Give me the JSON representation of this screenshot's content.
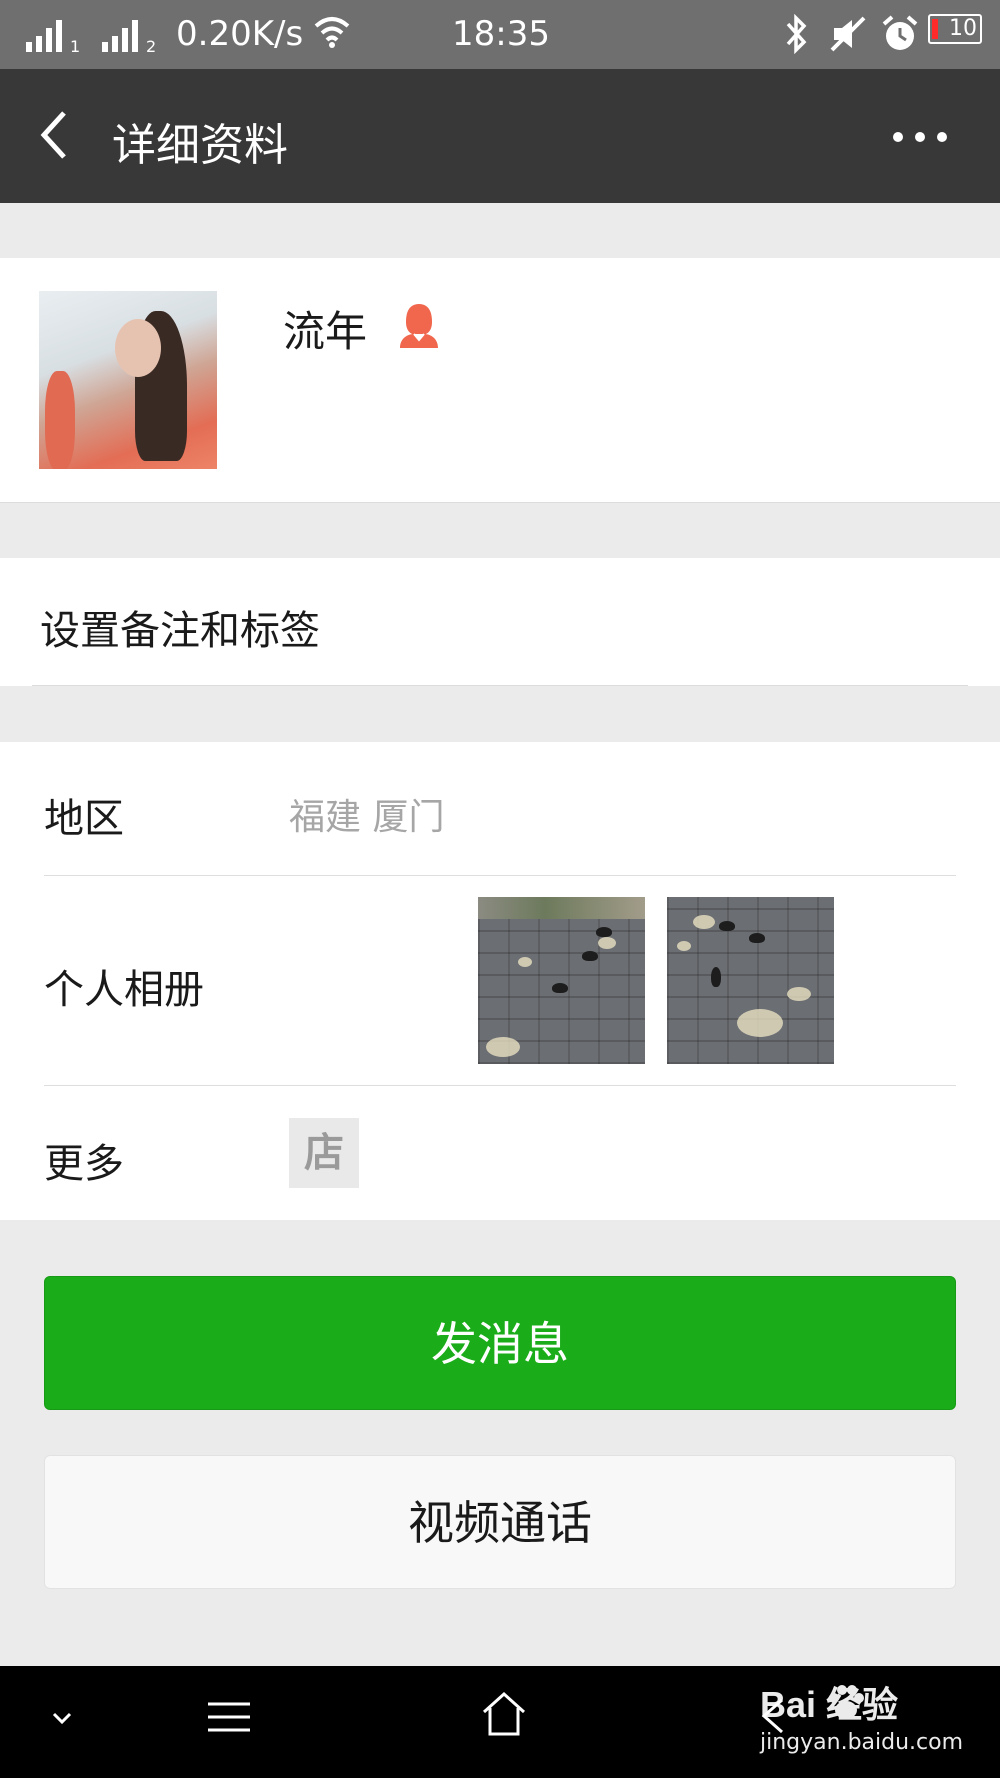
{
  "status_bar": {
    "sim1_label": "1",
    "sim2_label": "2",
    "network_speed": "0.20K/s",
    "time": "18:35",
    "battery_level": "10",
    "icons": [
      "signal-icon",
      "wifi-icon",
      "bluetooth-icon",
      "mute-icon",
      "alarm-icon",
      "battery-icon"
    ]
  },
  "title_bar": {
    "title": "详细资料",
    "back_icon": "chevron-left-icon",
    "more_icon": "more-dots-icon"
  },
  "profile": {
    "name": "流年",
    "gender_icon": "female-user-icon",
    "gender_color": "#f0674d"
  },
  "remark": {
    "label": "设置备注和标签"
  },
  "info": {
    "region_label": "地区",
    "region_value": "福建  厦门",
    "album_label": "个人相册",
    "more_label": "更多",
    "shop_icon_text": "店"
  },
  "buttons": {
    "send_message": "发消息",
    "video_call": "视频通话",
    "send_color": "#1aad19"
  },
  "watermark": {
    "brand": "Bai  经验",
    "url": "jingyan.baidu.com"
  }
}
